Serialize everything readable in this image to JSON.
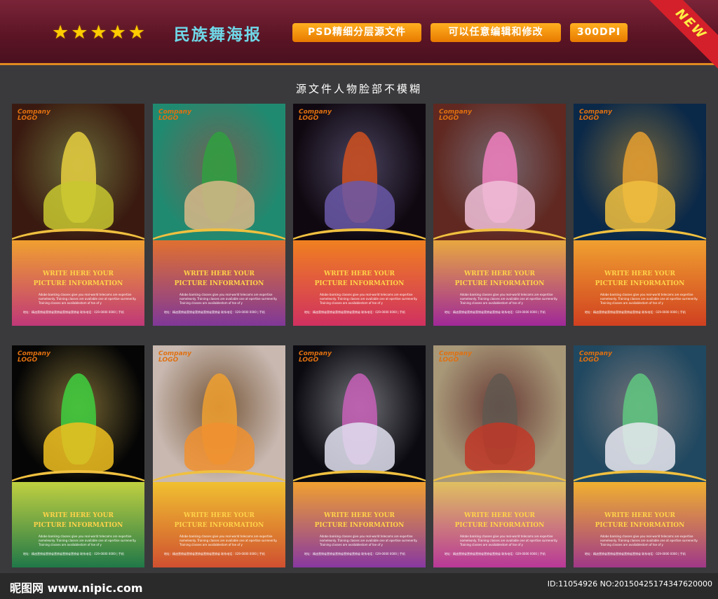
{
  "header": {
    "title": "民族舞海报",
    "badges": [
      "PSD精细分层源文件",
      "可以任意编辑和修改",
      "300DPI"
    ],
    "ribbon": "NEW",
    "star_color": "#ffcc00",
    "accent": "#e08a20"
  },
  "subtitle": "源文件人物脸部不模糊",
  "poster_text": {
    "title1": "WRITE HERE YOUR",
    "title2": "PICTURE INFORMATION",
    "blurb": "Adobe banking classes give you real-world telecoms are expertise nomeleonly. Training classes are available one at epertise surrenerity. Training classes are availablestom of tse of y",
    "contact": "地址：精迪营销省营销省营销省营销省营销省  联系电话：029-0000 0000 | 手机",
    "logo_top": "Company",
    "logo_bottom": "LOGO"
  },
  "posters": [
    {
      "bg": "#3a1a10",
      "lower": "linear-gradient(#f0a030,#c03878)",
      "fig": "#e8d040",
      "fig2": "#c8c830"
    },
    {
      "bg": "#208a70",
      "lower": "linear-gradient(#e07030,#803898)",
      "fig": "#30a040",
      "fig2": "#d8b888"
    },
    {
      "bg": "#100810",
      "lower": "linear-gradient(#f08020,#d03060)",
      "fig": "#d05020",
      "fig2": "#6a58a8"
    },
    {
      "bg": "#602820",
      "lower": "linear-gradient(#e8a840,#a02898)",
      "fig": "#f080c0",
      "fig2": "#f0c0d8"
    },
    {
      "bg": "#0a2848",
      "lower": "linear-gradient(#f0a030,#d04020)",
      "fig": "#e8a030",
      "fig2": "#f0c040"
    },
    {
      "bg": "#050505",
      "lower": "linear-gradient(#c0d040,#207848)",
      "fig": "#40d040",
      "fig2": "#f0c020"
    },
    {
      "bg": "#c8b8b0",
      "lower": "linear-gradient(#f0c030,#d05030)",
      "fig": "#f0a030",
      "fig2": "#f09030"
    },
    {
      "bg": "#0a0a10",
      "lower": "linear-gradient(#f0a030,#8838a0)",
      "fig": "#c860b8",
      "fig2": "#e0e0f0"
    },
    {
      "bg": "#a89878",
      "lower": "linear-gradient(#e0c060,#b83898)",
      "fig": "#605850",
      "fig2": "#c03828"
    },
    {
      "bg": "#204860",
      "lower": "linear-gradient(#f0b030,#a03888)",
      "fig": "#60c880",
      "fig2": "#e8e8f0"
    }
  ],
  "footer": {
    "watermark": "昵图网 www.nipic.com",
    "image_id": "ID:11054926 NO:20150425174347620000"
  }
}
